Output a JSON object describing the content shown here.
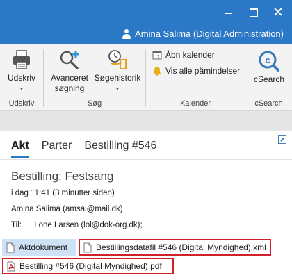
{
  "window": {
    "user_link": "Amina Salima (Digital Administration)"
  },
  "ribbon": {
    "groups": {
      "print": {
        "label": "Udskriv",
        "button": "Udskriv"
      },
      "search": {
        "label": "Søg",
        "advanced_line1": "Avanceret",
        "advanced_line2": "søgning",
        "history": "Søgehistorik"
      },
      "calendar": {
        "label": "Kalender",
        "open": "Åbn kalender",
        "reminders": "Vis alle påmindelser"
      },
      "csearch": {
        "label": "cSearch",
        "button": "cSearch"
      }
    },
    "colors": {
      "brand": "#2b78c6",
      "csearch": "#3a79b8",
      "highlight": "#d21f2a"
    }
  },
  "tabs": [
    "Akt",
    "Parter",
    "Bestilling #546"
  ],
  "message": {
    "subject": "Bestilling: Festsang",
    "time": "i dag 11:41 (3 minutter siden)",
    "from": "Amina Salima (amsal@mail.dk)",
    "to_label": "Til:",
    "to": "Lone Larsen (lol@dok-org.dk);"
  },
  "attachments": [
    {
      "name": "Aktdokument",
      "icon": "document-icon"
    },
    {
      "name": "Bestillingsdatafil #546 (Digital Myndighed).xml",
      "icon": "file-icon"
    },
    {
      "name": "Bestilling #546 (Digital Myndighed).pdf",
      "icon": "pdf-icon"
    }
  ]
}
